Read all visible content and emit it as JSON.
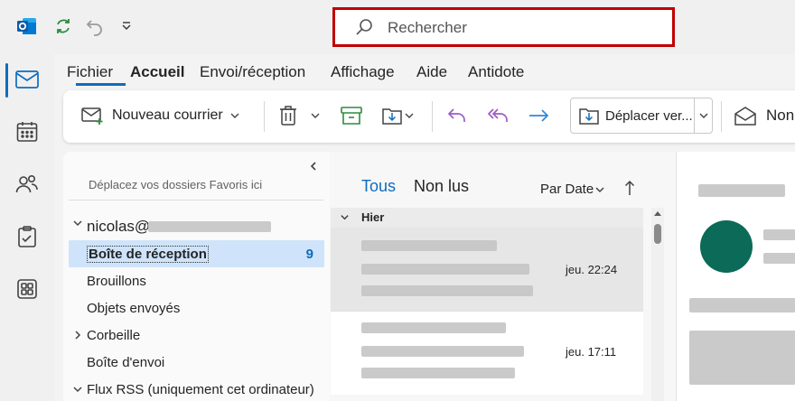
{
  "search": {
    "placeholder": "Rechercher"
  },
  "menu": {
    "tabs": [
      "Fichier",
      "Accueil",
      "Envoi/réception",
      "Affichage",
      "Aide",
      "Antidote"
    ],
    "active": "Accueil"
  },
  "ribbon": {
    "new_mail": "Nouveau courrier",
    "move_to": "Déplacer ver...",
    "next_partial": "Non"
  },
  "folders": {
    "favorites_hint": "Déplacez vos dossiers Favoris ici",
    "account_prefix": "nicolas@",
    "items": [
      {
        "label": "Boîte de réception",
        "count": "9",
        "selected": true
      },
      {
        "label": "Brouillons"
      },
      {
        "label": "Objets envoyés"
      },
      {
        "label": "Corbeille",
        "expandable": true
      },
      {
        "label": "Boîte d'envoi"
      },
      {
        "label": "Flux RSS (uniquement cet ordinateur)",
        "expandable": true,
        "expanded": true
      }
    ]
  },
  "message_list": {
    "tabs": [
      "Tous",
      "Non lus"
    ],
    "active_tab": "Tous",
    "sort_label": "Par Date",
    "group_header": "Hier",
    "messages": [
      {
        "date": "jeu. 22:24",
        "selected": true
      },
      {
        "date": "jeu. 17:11",
        "selected": false
      }
    ]
  },
  "colors": {
    "accent": "#0f6cbd",
    "search_border": "#c00000",
    "selected_folder": "#cfe4fa",
    "selected_message": "#e6e6e6"
  }
}
